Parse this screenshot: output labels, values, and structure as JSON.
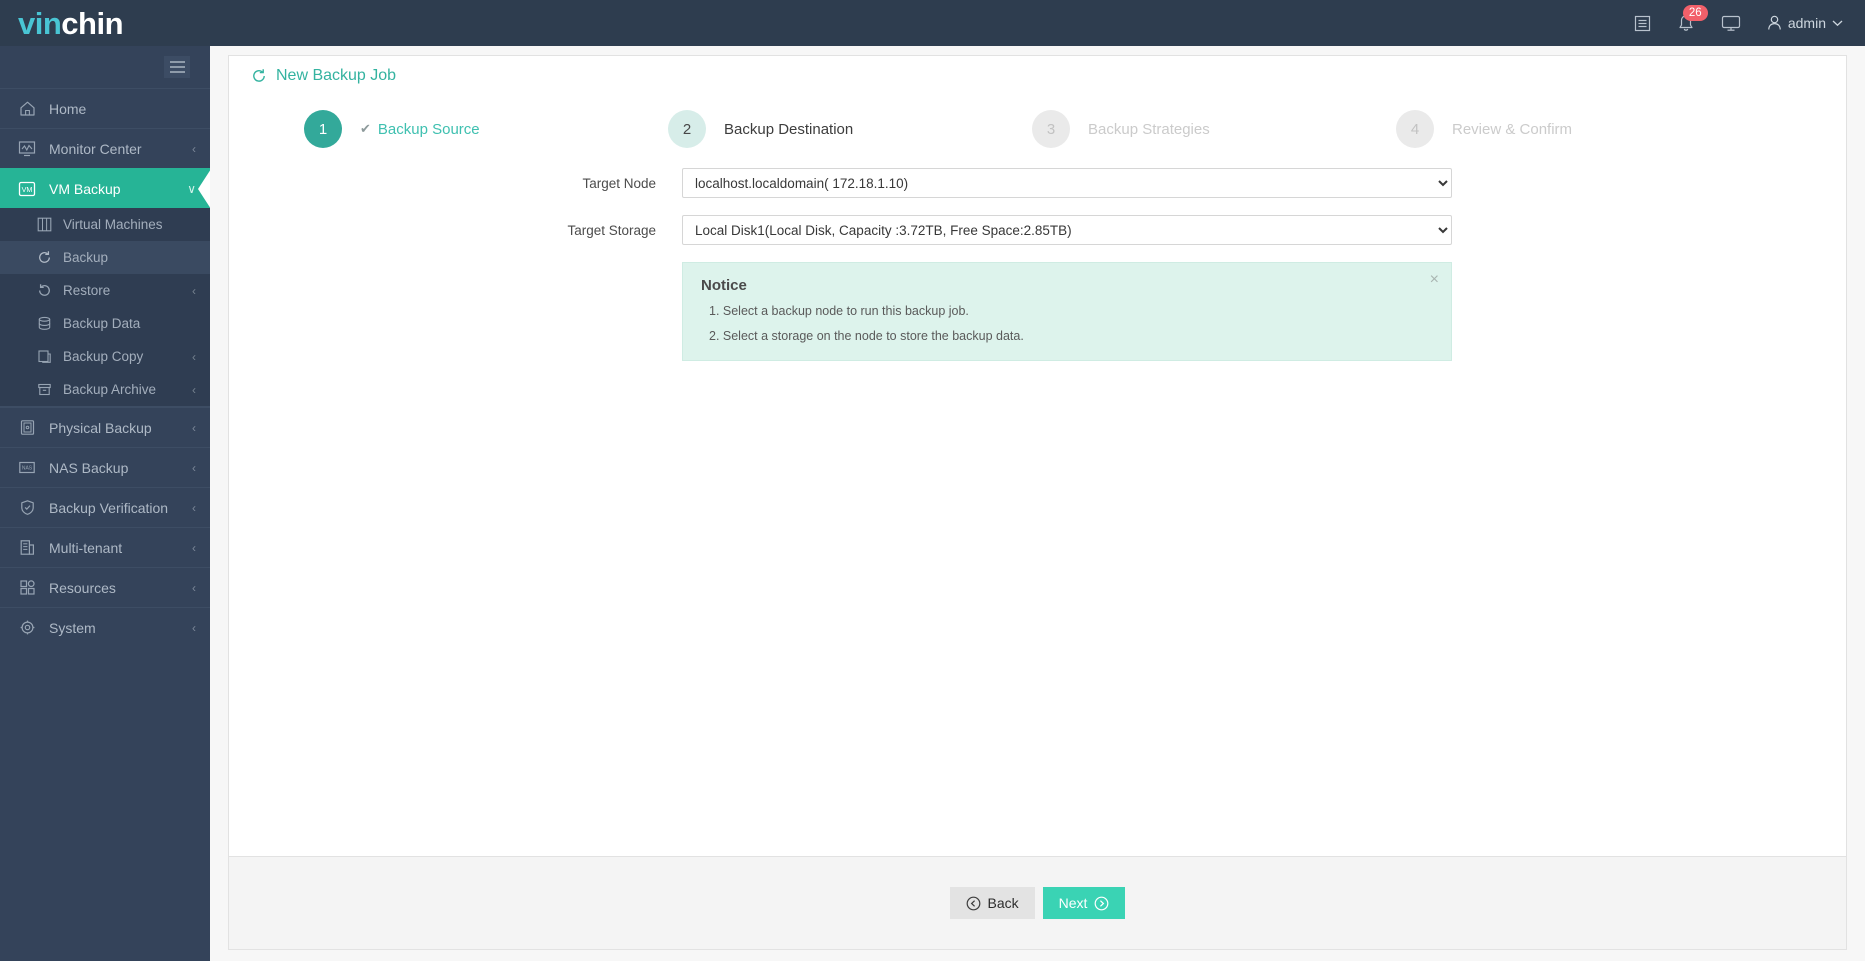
{
  "app": {
    "logo_first": "vin",
    "logo_second": "chin"
  },
  "topbar": {
    "notification_count": "26",
    "user_label": "admin",
    "icons": {
      "list": "list-icon",
      "bell": "bell-icon",
      "monitor": "monitor-icon",
      "user": "user-icon",
      "chevron": "chevron-down-icon"
    }
  },
  "sidebar": {
    "toggle": "hamburger-icon",
    "items": [
      {
        "label": "Home",
        "icon": "home-icon",
        "chevron": "",
        "active": false
      },
      {
        "label": "Monitor Center",
        "icon": "monitor-chart-icon",
        "chevron": "‹",
        "active": false
      },
      {
        "label": "VM Backup",
        "icon": "vm-icon",
        "chevron": "∨",
        "active": true
      }
    ],
    "submenu": [
      {
        "label": "Virtual Machines",
        "icon": "grid-icon",
        "chevron": "",
        "selected": false
      },
      {
        "label": "Backup",
        "icon": "refresh-icon",
        "chevron": "",
        "selected": true
      },
      {
        "label": "Restore",
        "icon": "restore-icon",
        "chevron": "‹",
        "selected": false
      },
      {
        "label": "Backup Data",
        "icon": "database-icon",
        "chevron": "",
        "selected": false
      },
      {
        "label": "Backup Copy",
        "icon": "copy-icon",
        "chevron": "‹",
        "selected": false
      },
      {
        "label": "Backup Archive",
        "icon": "archive-icon",
        "chevron": "‹",
        "selected": false
      }
    ],
    "items_after": [
      {
        "label": "Physical Backup",
        "icon": "server-icon",
        "chevron": "‹",
        "active": false
      },
      {
        "label": "NAS Backup",
        "icon": "nas-icon",
        "chevron": "‹",
        "active": false
      },
      {
        "label": "Backup Verification",
        "icon": "shield-check-icon",
        "chevron": "‹",
        "active": false
      },
      {
        "label": "Multi-tenant",
        "icon": "building-icon",
        "chevron": "‹",
        "active": false
      },
      {
        "label": "Resources",
        "icon": "blocks-icon",
        "chevron": "‹",
        "active": false
      },
      {
        "label": "System",
        "icon": "gear-icon",
        "chevron": "‹",
        "active": false
      }
    ]
  },
  "page": {
    "title": "New Backup Job",
    "title_icon": "refresh-icon"
  },
  "stepper": [
    {
      "number": "1",
      "label": "Backup Source",
      "state": "done",
      "check": "✔"
    },
    {
      "number": "2",
      "label": "Backup Destination",
      "state": "current",
      "check": ""
    },
    {
      "number": "3",
      "label": "Backup Strategies",
      "state": "todo",
      "check": ""
    },
    {
      "number": "4",
      "label": "Review & Confirm",
      "state": "todo",
      "check": ""
    }
  ],
  "form": {
    "target_node": {
      "label": "Target Node",
      "value": "localhost.localdomain( 172.18.1.10)"
    },
    "target_storage": {
      "label": "Target Storage",
      "value": "Local Disk1(Local Disk, Capacity :3.72TB, Free Space:2.85TB)"
    }
  },
  "notice": {
    "title": "Notice",
    "close": "×",
    "lines": [
      "1. Select a backup node to run this backup job.",
      "2. Select a storage on the node to store the backup data."
    ]
  },
  "footer": {
    "back_label": "Back",
    "next_label": "Next"
  },
  "colors": {
    "topbar": "#2e3d4f",
    "sidebar": "#34435a",
    "accent_teal": "#26b496",
    "next_button": "#3ad3b4",
    "title_teal": "#34b3a0",
    "badge_red": "#f2606a",
    "notice_bg": "#ddf3ec"
  }
}
